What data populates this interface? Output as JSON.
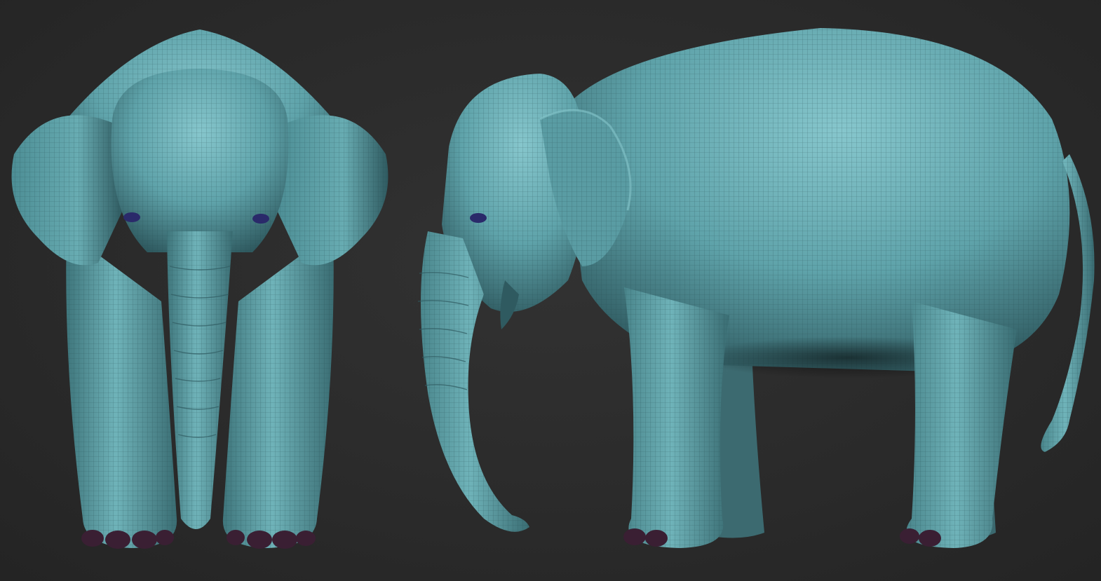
{
  "scene": {
    "background_color": "#2b2b2b",
    "model_color": "#5fa3aa",
    "model_shadow_color": "#2f5a60",
    "model_highlight_color": "#86c6cc",
    "wire_color": "#24474c",
    "toenail_color": "#3a1f33",
    "eye_color": "#2a2a6a"
  },
  "views": [
    {
      "id": "front",
      "subject": "elephant-front-view"
    },
    {
      "id": "side",
      "subject": "elephant-side-view"
    }
  ]
}
